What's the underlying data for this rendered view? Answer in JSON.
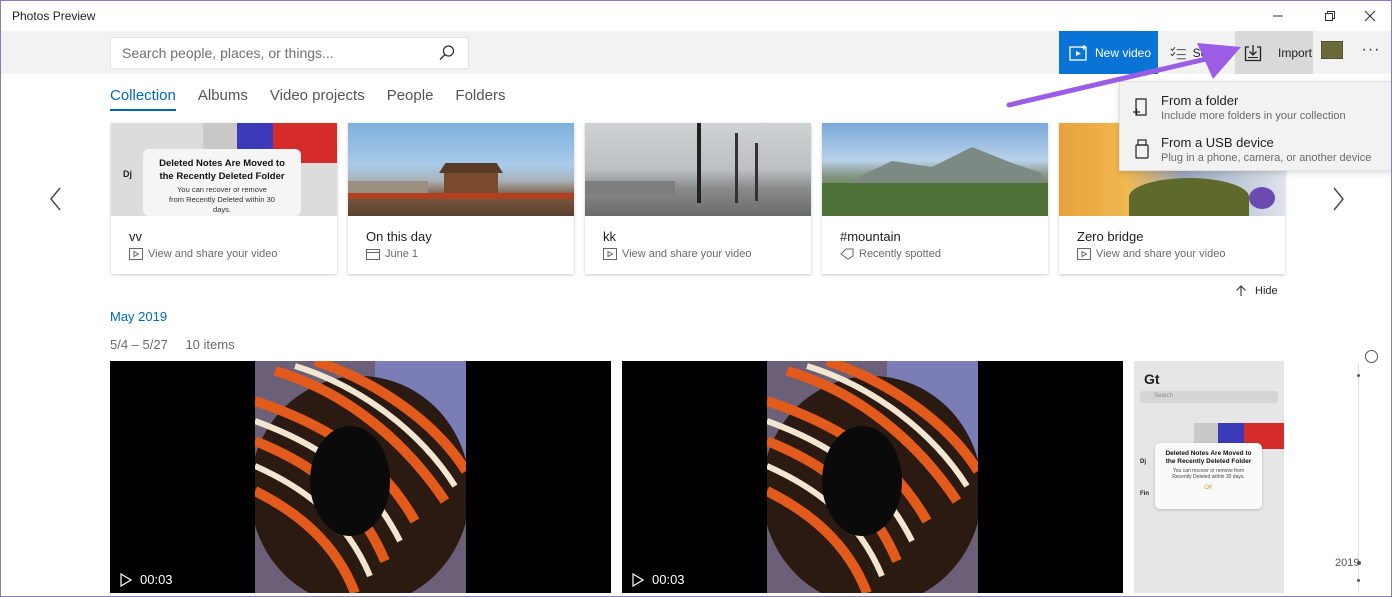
{
  "window": {
    "title": "Photos Preview"
  },
  "toolbar": {
    "search_placeholder": "Search people, places, or things...",
    "new_video_label": "New video",
    "select_label": "Select",
    "import_label": "Import",
    "more_label": "···"
  },
  "tabs": [
    {
      "label": "Collection",
      "active": true
    },
    {
      "label": "Albums"
    },
    {
      "label": "Video projects"
    },
    {
      "label": "People"
    },
    {
      "label": "Folders"
    }
  ],
  "import_menu": [
    {
      "title": "From a folder",
      "subtitle": "Include more folders in your collection",
      "icon": "folder-add-icon"
    },
    {
      "title": "From a USB device",
      "subtitle": "Plug in a phone, camera, or another device",
      "icon": "usb-icon"
    }
  ],
  "cards": [
    {
      "title": "vv",
      "subtitle": "View and share your video",
      "icon": "video-icon"
    },
    {
      "title": "On this day",
      "subtitle": "June 1",
      "icon": "calendar-icon"
    },
    {
      "title": "kk",
      "subtitle": "View and share your video",
      "icon": "video-icon"
    },
    {
      "title": "#mountain",
      "subtitle": "Recently spotted",
      "icon": "tag-icon"
    },
    {
      "title": "Zero bridge",
      "subtitle": "View and share your video",
      "icon": "video-icon"
    }
  ],
  "card_thumb_text": {
    "heading": "Deleted Notes Are Moved to the Recently Deleted Folder",
    "body": "You can recover or remove from Recently Deleted within 30 days.",
    "side_label": "Dj"
  },
  "hide_label": "Hide",
  "section": {
    "month": "May 2019",
    "date_range": "5/4 – 5/27",
    "item_count": "10 items"
  },
  "tiles": [
    {
      "duration": "00:03"
    },
    {
      "duration": "00:03"
    }
  ],
  "tile3_text": {
    "title": "Gt",
    "search": "Search",
    "heading": "Deleted Notes Are Moved to the Recently Deleted Folder",
    "body": "You can recover or remove from Recently Deleted within 30 days.",
    "ok": "OK",
    "side1": "Dj",
    "side2": "Fin"
  },
  "timeline": {
    "year": "2019"
  },
  "colors": {
    "accent": "#0067c0",
    "new_video_bg": "#0a74d6",
    "annotation": "#9b5de5"
  }
}
